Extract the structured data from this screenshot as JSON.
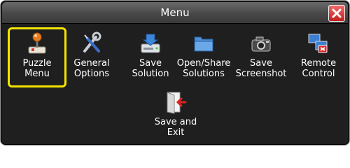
{
  "window": {
    "title": "Menu",
    "close_icon": "close-icon",
    "close_color": "#d42a2a"
  },
  "items": [
    {
      "id": "puzzle-menu",
      "label": "Puzzle\nMenu",
      "icon": "joystick-icon",
      "selected": true
    },
    {
      "id": "general-options",
      "label": "General\nOptions",
      "icon": "wrench-screwdriver-icon",
      "selected": false
    },
    {
      "id": "save-solution",
      "label": "Save\nSolution",
      "icon": "save-drive-icon",
      "selected": false
    },
    {
      "id": "open-share-solutions",
      "label": "Open/Share\nSolutions",
      "icon": "folder-icon",
      "selected": false
    },
    {
      "id": "save-screenshot",
      "label": "Save\nScreenshot",
      "icon": "camera-icon",
      "selected": false
    },
    {
      "id": "remote-control",
      "label": "Remote\nControl",
      "icon": "network-computers-icon",
      "selected": false
    },
    {
      "id": "save-and-exit",
      "label": "Save and\nExit",
      "icon": "exit-door-icon",
      "selected": false
    }
  ],
  "colors": {
    "selection_border": "#f5e400",
    "panel_background": "#1f1f1f"
  }
}
